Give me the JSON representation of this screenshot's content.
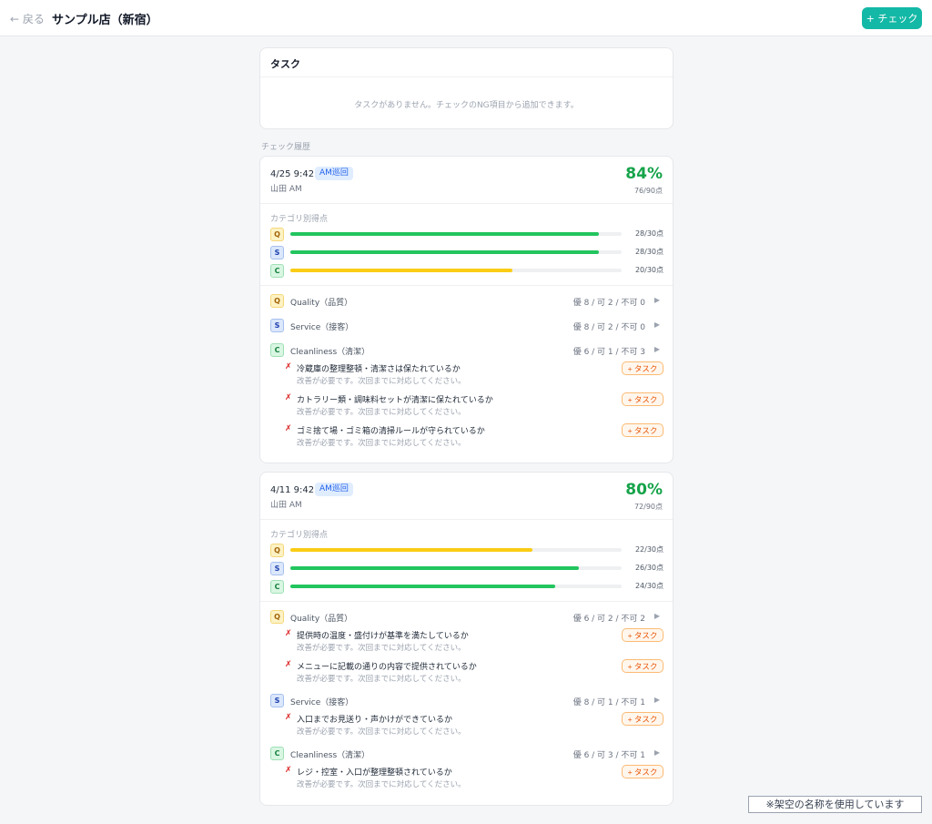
{
  "header": {
    "back_label": "← 戻る",
    "title": "サンプル店（新宿）",
    "check_button": "+ チェック"
  },
  "tasks": {
    "title": "タスク",
    "empty_message": "タスクがありません。チェックのNG項目から追加できます。"
  },
  "history_label": "チェック履歴",
  "records": [
    {
      "date": "4/25 9:42",
      "badge": "AM巡回",
      "user": "山田 AM",
      "percent": "84%",
      "points": "76/90点",
      "category_title": "カテゴリ別得点",
      "categories": [
        {
          "code": "Q",
          "score": "28/30点",
          "fill": 0.93,
          "color": "#22c55e"
        },
        {
          "code": "S",
          "score": "28/30点",
          "fill": 0.93,
          "color": "#22c55e"
        },
        {
          "code": "C",
          "score": "20/30点",
          "fill": 0.67,
          "color": "#facc15"
        }
      ],
      "groups": [
        {
          "code": "Q",
          "name": "Quality（品質）",
          "stats": "優 8 / 可 2 / 不可 0",
          "items": []
        },
        {
          "code": "S",
          "name": "Service（接客）",
          "stats": "優 8 / 可 2 / 不可 0",
          "items": []
        },
        {
          "code": "C",
          "name": "Cleanliness（清潔）",
          "stats": "優 6 / 可 1 / 不可 3",
          "items": [
            {
              "text": "冷蔵庫の整理整頓・清潔さは保たれているか",
              "note": "改善が必要です。次回までに対応してください。"
            },
            {
              "text": "カトラリー類・調味料セットが清潔に保たれているか",
              "note": "改善が必要です。次回までに対応してください。"
            },
            {
              "text": "ゴミ捨て場・ゴミ箱の清掃ルールが守られているか",
              "note": "改善が必要です。次回までに対応してください。"
            }
          ]
        }
      ]
    },
    {
      "date": "4/11 9:42",
      "badge": "AM巡回",
      "user": "山田 AM",
      "percent": "80%",
      "points": "72/90点",
      "category_title": "カテゴリ別得点",
      "categories": [
        {
          "code": "Q",
          "score": "22/30点",
          "fill": 0.73,
          "color": "#facc15"
        },
        {
          "code": "S",
          "score": "26/30点",
          "fill": 0.87,
          "color": "#22c55e"
        },
        {
          "code": "C",
          "score": "24/30点",
          "fill": 0.8,
          "color": "#22c55e"
        }
      ],
      "groups": [
        {
          "code": "Q",
          "name": "Quality（品質）",
          "stats": "優 6 / 可 2 / 不可 2",
          "items": [
            {
              "text": "提供時の温度・盛付けが基準を満たしているか",
              "note": "改善が必要です。次回までに対応してください。"
            },
            {
              "text": "メニューに記載の通りの内容で提供されているか",
              "note": "改善が必要です。次回までに対応してください。"
            }
          ]
        },
        {
          "code": "S",
          "name": "Service（接客）",
          "stats": "優 8 / 可 1 / 不可 1",
          "items": [
            {
              "text": "入口までお見送り・声かけができているか",
              "note": "改善が必要です。次回までに対応してください。"
            }
          ]
        },
        {
          "code": "C",
          "name": "Cleanliness（清潔）",
          "stats": "優 6 / 可 3 / 不可 1",
          "items": [
            {
              "text": "レジ・控室・入口が整理整頓されているか",
              "note": "改善が必要です。次回までに対応してください。"
            }
          ]
        }
      ]
    }
  ],
  "task_button_label": "+ タスク",
  "ng_mark": "✗",
  "expand_glyph": "▶",
  "footnote": "※架空の名称を使用しています"
}
